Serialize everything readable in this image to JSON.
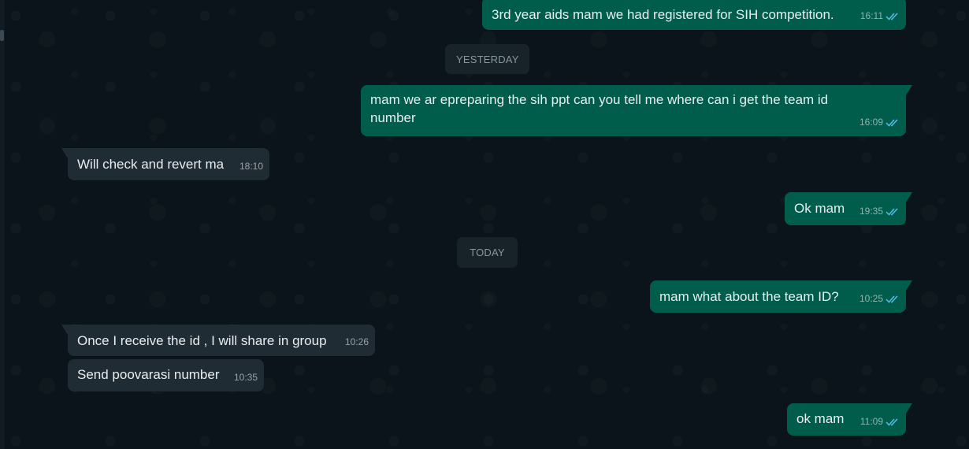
{
  "date_separators": {
    "yesterday": "YESTERDAY",
    "today": "TODAY"
  },
  "messages": [
    {
      "text": "3rd year aids mam we had registered for SIH competition.",
      "time": "16:11",
      "direction": "outgoing",
      "status": "read"
    },
    {
      "text": "mam we ar epreparing the sih ppt can you tell me where can i get the team id number",
      "time": "16:09",
      "direction": "outgoing",
      "status": "read"
    },
    {
      "text": "Will check and revert ma",
      "time": "18:10",
      "direction": "incoming"
    },
    {
      "text": "Ok mam",
      "time": "19:35",
      "direction": "outgoing",
      "status": "read"
    },
    {
      "text": "mam what about the team ID?",
      "time": "10:25",
      "direction": "outgoing",
      "status": "read"
    },
    {
      "text": "Once I receive the id , I will share in group",
      "time": "10:26",
      "direction": "incoming"
    },
    {
      "text": "Send poovarasi number",
      "time": "10:35",
      "direction": "incoming"
    },
    {
      "text": "ok mam",
      "time": "11:09",
      "direction": "outgoing",
      "status": "read"
    }
  ],
  "colors": {
    "background": "#0b141a",
    "outgoing_bubble": "#005c4b",
    "incoming_bubble": "#202c33",
    "read_tick": "#53bdeb",
    "date_pill": "#182229"
  }
}
